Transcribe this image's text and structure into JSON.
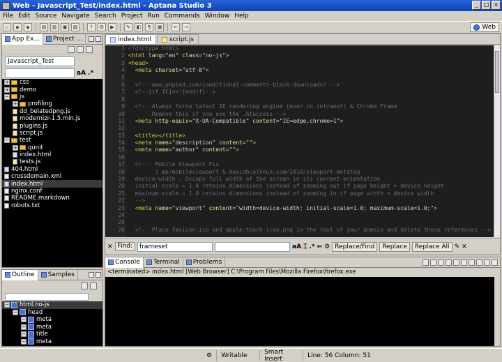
{
  "window": {
    "title": "Web - Javascript_Test/index.html - Aptana Studio 3"
  },
  "menu": [
    "File",
    "Edit",
    "Source",
    "Navigate",
    "Search",
    "Project",
    "Run",
    "Commands",
    "Window",
    "Help"
  ],
  "toolbar": {
    "perspective_label": "Web"
  },
  "explorer": {
    "tabs": [
      {
        "label": "App Ex..."
      },
      {
        "label": "Project ..."
      }
    ],
    "project": "Javascript_Test",
    "filter_placeholder": "",
    "tree": [
      {
        "label": "css",
        "type": "folder",
        "indent": 0,
        "expanded": false
      },
      {
        "label": "demo",
        "type": "folder",
        "indent": 0,
        "expanded": false
      },
      {
        "label": "js",
        "type": "folder",
        "indent": 0,
        "expanded": true
      },
      {
        "label": "profiling",
        "type": "folder",
        "indent": 1,
        "expanded": false
      },
      {
        "label": "dd_belatedpng.js",
        "type": "js",
        "indent": 1
      },
      {
        "label": "modernizr-1.5.min.js",
        "type": "js",
        "indent": 1
      },
      {
        "label": "plugins.js",
        "type": "js",
        "indent": 1
      },
      {
        "label": "script.js",
        "type": "js",
        "indent": 1
      },
      {
        "label": "test",
        "type": "folder",
        "indent": 0,
        "expanded": true
      },
      {
        "label": "qunit",
        "type": "folder",
        "indent": 1,
        "expanded": false
      },
      {
        "label": "index.html",
        "type": "html",
        "indent": 1
      },
      {
        "label": "tests.js",
        "type": "js",
        "indent": 1
      },
      {
        "label": "404.html",
        "type": "html",
        "indent": 0
      },
      {
        "label": "crossdomain.xml",
        "type": "file",
        "indent": 0
      },
      {
        "label": "index.html",
        "type": "html",
        "indent": 0,
        "selected": true
      },
      {
        "label": "nginx.conf",
        "type": "file",
        "indent": 0
      },
      {
        "label": "README.markdown",
        "type": "file",
        "indent": 0
      },
      {
        "label": "robots.txt",
        "type": "file",
        "indent": 0
      }
    ]
  },
  "outline": {
    "tabs": [
      {
        "label": "Outline"
      },
      {
        "label": "Samples"
      }
    ],
    "tree": [
      {
        "label": "html.no-js",
        "indent": 0,
        "selected": true
      },
      {
        "label": "head",
        "indent": 1
      },
      {
        "label": "meta",
        "indent": 2
      },
      {
        "label": "meta",
        "indent": 2
      },
      {
        "label": "title",
        "indent": 2
      },
      {
        "label": "meta",
        "indent": 2
      },
      {
        "label": "meta",
        "indent": 2
      }
    ]
  },
  "editor": {
    "tabs": [
      {
        "label": "index.html",
        "active": true,
        "kind": "html"
      },
      {
        "label": "script.js",
        "active": false,
        "kind": "js"
      }
    ],
    "lines": [
      {
        "n": "1",
        "segs": [
          [
            "c-comment",
            "<!doctype html>"
          ]
        ]
      },
      {
        "n": "2",
        "segs": [
          [
            "c-tag",
            "<html "
          ],
          [
            "c-attr",
            "lang="
          ],
          [
            "c-val",
            "\"en\" "
          ],
          [
            "c-attr",
            "class="
          ],
          [
            "c-val",
            "\"no-js\""
          ],
          [
            "c-tag",
            ">"
          ]
        ]
      },
      {
        "n": "3",
        "segs": [
          [
            "c-tag",
            "<head>"
          ]
        ]
      },
      {
        "n": "4",
        "segs": [
          [
            "c-tag",
            "  <meta "
          ],
          [
            "c-attr",
            "charset="
          ],
          [
            "c-val",
            "\"utf-8\""
          ],
          [
            "c-tag",
            ">"
          ]
        ]
      },
      {
        "n": "5",
        "segs": []
      },
      {
        "n": "6",
        "segs": [
          [
            "c-comment",
            "  <!-- www.phpied.com/conditional-comments-block-downloads/ -->"
          ]
        ]
      },
      {
        "n": "7",
        "segs": [
          [
            "c-comment",
            "  <!--[if IE]><![endif]-->"
          ]
        ]
      },
      {
        "n": "8",
        "segs": []
      },
      {
        "n": "9",
        "segs": [
          [
            "c-comment",
            "  <!-- Always force latest IE rendering engine (even in intranet) & Chrome Frame"
          ]
        ]
      },
      {
        "n": "10",
        "segs": [
          [
            "c-comment",
            "       Remove this if you use the .htaccess -->"
          ]
        ]
      },
      {
        "n": "11",
        "segs": [
          [
            "c-tag",
            "  <meta "
          ],
          [
            "c-attr",
            "http-equiv="
          ],
          [
            "c-val",
            "\"X-UA-Compatible\" "
          ],
          [
            "c-attr",
            "content="
          ],
          [
            "c-val",
            "\"IE=edge,chrome=1\""
          ],
          [
            "c-tag",
            ">"
          ]
        ]
      },
      {
        "n": "12",
        "segs": []
      },
      {
        "n": "13",
        "segs": [
          [
            "c-tag",
            "  <title></title>"
          ]
        ]
      },
      {
        "n": "14",
        "segs": [
          [
            "c-tag",
            "  <meta "
          ],
          [
            "c-attr",
            "name="
          ],
          [
            "c-val",
            "\"description\" "
          ],
          [
            "c-attr",
            "content="
          ],
          [
            "c-val",
            "\"\""
          ],
          [
            "c-tag",
            ">"
          ]
        ]
      },
      {
        "n": "15",
        "segs": [
          [
            "c-tag",
            "  <meta "
          ],
          [
            "c-attr",
            "name="
          ],
          [
            "c-val",
            "\"author\" "
          ],
          [
            "c-attr",
            "content="
          ],
          [
            "c-val",
            "\"\""
          ],
          [
            "c-tag",
            ">"
          ]
        ]
      },
      {
        "n": "16",
        "segs": []
      },
      {
        "n": "17",
        "segs": [
          [
            "c-comment",
            "  <!--  Mobile Viewport Fix"
          ]
        ]
      },
      {
        "n": "18",
        "segs": [
          [
            "c-comment",
            "        j.mp/mobileviewport & davidbcalhoun.com/2010/viewport-metatag"
          ]
        ]
      },
      {
        "n": "19",
        "segs": [
          [
            "c-comment",
            "  device-width : Occupy full width of the screen in its current orientation"
          ]
        ]
      },
      {
        "n": "20",
        "segs": [
          [
            "c-comment",
            "  initial-scale = 1.0 retains dimensions instead of zooming out if page height > device height"
          ]
        ]
      },
      {
        "n": "21",
        "segs": [
          [
            "c-comment",
            "  maximum-scale = 1.0 retains dimensions instead of zooming in if page width < device width"
          ]
        ]
      },
      {
        "n": "22",
        "segs": [
          [
            "c-comment",
            "  -->"
          ]
        ]
      },
      {
        "n": "23",
        "segs": [
          [
            "c-tag",
            "  <meta "
          ],
          [
            "c-attr",
            "name="
          ],
          [
            "c-val",
            "\"viewport\" "
          ],
          [
            "c-attr",
            "content="
          ],
          [
            "c-val",
            "\"width=device-width; initial-scale=1.0; maximum-scale=1.0;\""
          ],
          [
            "c-tag",
            ">"
          ]
        ]
      },
      {
        "n": "24",
        "segs": []
      },
      {
        "n": "25",
        "segs": []
      },
      {
        "n": "26",
        "segs": [
          [
            "c-comment",
            "  <!-- Place favicon.ico and apple-touch-icon.png in the root of your domain and delete these references -->"
          ]
        ]
      }
    ]
  },
  "find_bar": {
    "find_label": "Find:",
    "find_value": "frameset",
    "replace_value": "",
    "aa_label": "aA",
    "replace_find_label": "Replace/Find",
    "replace_label": "Replace",
    "replace_all_label": "Replace All"
  },
  "console": {
    "tabs": [
      {
        "label": "Console"
      },
      {
        "label": "Terminal"
      },
      {
        "label": "Problems"
      }
    ],
    "info": "<terminated> index.html [Web Browser] C:\\Program Files\\Mozilla Firefox\\firefox.exe"
  },
  "status": {
    "writable": "Writable",
    "insert_mode": "Smart Insert",
    "position": "Line: 56 Column: 51"
  }
}
